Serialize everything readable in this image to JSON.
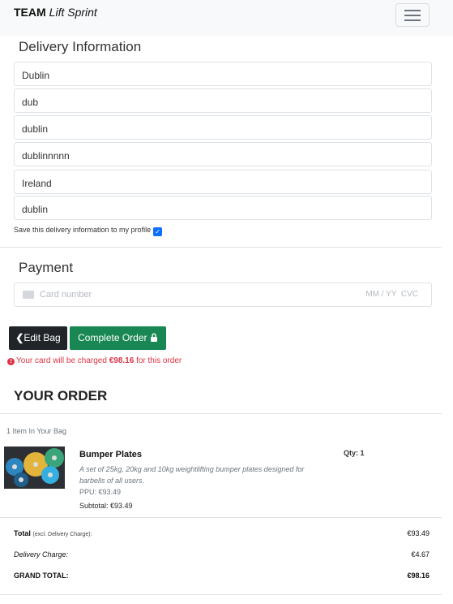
{
  "nav": {
    "brand_team": "TEAM",
    "brand_sub": "Lift Sprint"
  },
  "delivery": {
    "title": "Delivery Information",
    "fields": [
      "Dublin",
      "dub",
      "dublin",
      "dublinnnnn",
      "Ireland",
      "dublin"
    ],
    "save_label": "Save this delivery information to my profile",
    "save_checked": true
  },
  "payment": {
    "title": "Payment",
    "card_placeholder": "Card number",
    "expiry_cvc_placeholder": "MM / YY  CVC"
  },
  "buttons": {
    "edit_bag": "Edit Bag",
    "complete_order": "Complete Order"
  },
  "charge_note": {
    "prefix": "Your card will be charged ",
    "amount": "€98.16",
    "suffix": " for this order"
  },
  "order": {
    "title": "YOUR ORDER",
    "items_count": "1 Item In Your Bag",
    "item": {
      "name": "Bumper Plates",
      "description": "A set of 25kg, 20kg and 10kg weightlifting bumper plates designed for barbells of all users.",
      "ppu": "PPU: €93.49",
      "subtotal": "Subtotal: €93.49",
      "qty": "Qty: 1"
    },
    "totals": {
      "total_label": "Total",
      "total_note": "(excl. Delivery Charge):",
      "total_value": "€93.49",
      "delivery_label": "Delivery Charge:",
      "delivery_value": "€4.67",
      "grand_label": "GRAND TOTAL:",
      "grand_value": "€98.16"
    }
  },
  "colors": {
    "navbar_bg": "#f8f9fa",
    "edit_btn": "#212529",
    "complete_btn": "#198754",
    "error_text": "#dc3545",
    "checkbox": "#0d6efd"
  }
}
